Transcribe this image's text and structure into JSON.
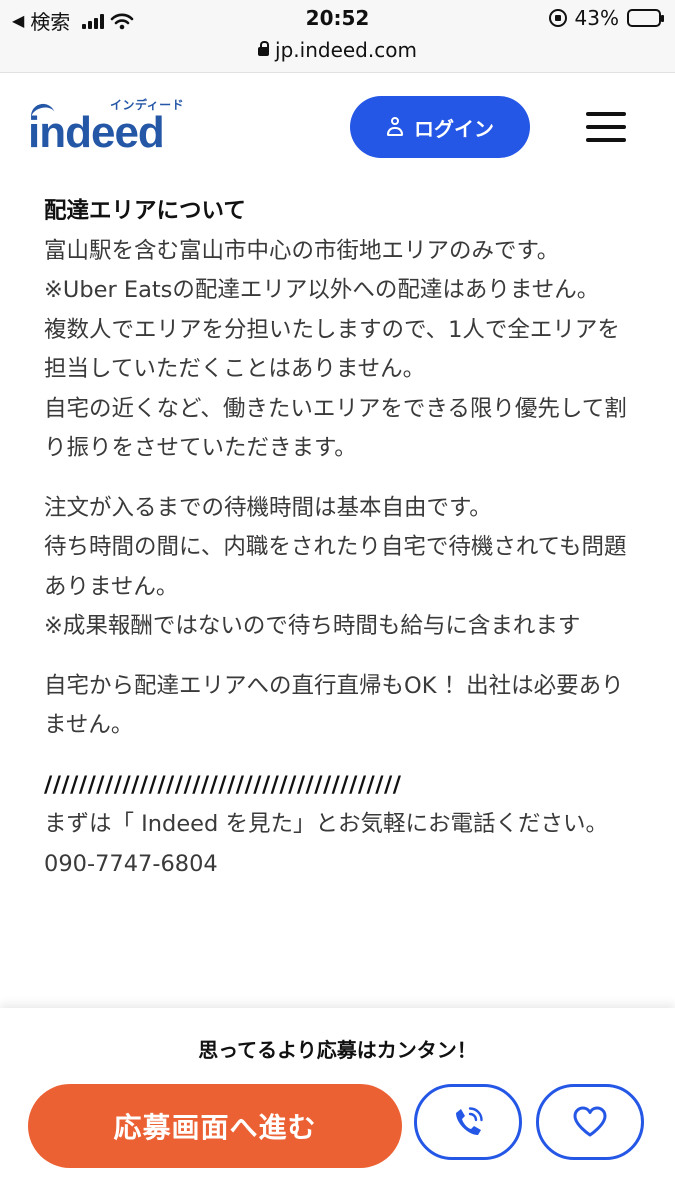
{
  "status_bar": {
    "back_label": "検索",
    "time": "20:52",
    "battery_percent": "43%",
    "battery_level": 0.43,
    "url": "jp.indeed.com"
  },
  "header": {
    "logo_word": "indeed",
    "logo_kana": "インディード",
    "login_label": "ログイン"
  },
  "content": {
    "heading": "配達エリアについて",
    "paragraphs": [
      "富山駅を含む富山市中心の市街地エリアのみです。",
      "※Uber Eatsの配達エリア以外への配達はありません。",
      "複数人でエリアを分担いたしますので、1人で全エリアを担当していただくことはありません。",
      "自宅の近くなど、働きたいエリアをできる限り優先して割り振りをさせていただきます。",
      "注文が入るまでの待機時間は基本自由です。",
      "待ち時間の間に、内職をされたり自宅で待機されても問題ありません。",
      "※成果報酬ではないので待ち時間も給与に含まれます",
      "自宅から配達エリアへの直行直帰もOK ！出社は必要ありません。",
      "/////////////////////////////////////////",
      "まずは「 Indeed を見た」とお気軽にお電話ください。",
      "090-7747-6804"
    ]
  },
  "bottom_bar": {
    "caption": "思ってるより応募はカンタン！",
    "apply_label": "応募画面へ進む"
  },
  "colors": {
    "brand_blue": "#2557a7",
    "button_blue": "#2557e6",
    "apply_orange": "#ec6133",
    "battery_green": "#34c759"
  }
}
